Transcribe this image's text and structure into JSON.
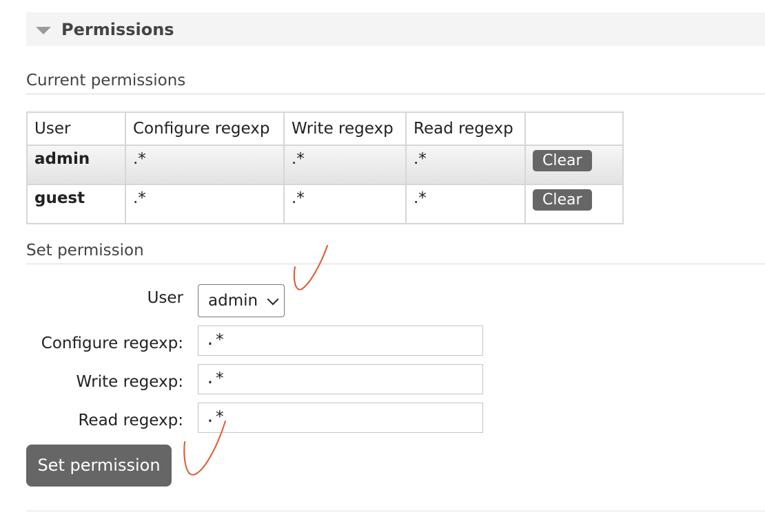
{
  "section": {
    "title": "Permissions"
  },
  "current": {
    "heading": "Current permissions",
    "columns": [
      "User",
      "Configure regexp",
      "Write regexp",
      "Read regexp",
      ""
    ],
    "rows": [
      {
        "user": "admin",
        "configure": ".*",
        "write": ".*",
        "read": ".*",
        "action": "Clear"
      },
      {
        "user": "guest",
        "configure": ".*",
        "write": ".*",
        "read": ".*",
        "action": "Clear"
      }
    ]
  },
  "set": {
    "heading": "Set permission",
    "user_label": "User",
    "user_value": "admin",
    "configure_label": "Configure regexp:",
    "configure_value": ".*",
    "write_label": "Write regexp:",
    "write_value": ".*",
    "read_label": "Read regexp:",
    "read_value": ".*",
    "button": "Set permission"
  },
  "colors": {
    "button": "#666666",
    "annotation": "#e4552d"
  }
}
